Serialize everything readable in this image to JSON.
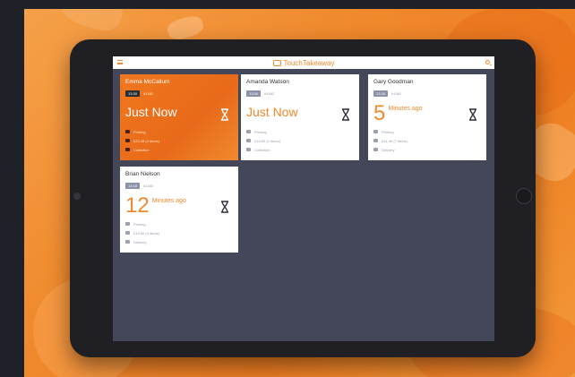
{
  "app": {
    "title": "TouchTakeaway"
  },
  "icons": {
    "menu": "menu-icon",
    "brand": "takeaway-logo-icon",
    "search": "search-icon",
    "hourglass": "hourglass-icon",
    "printing": "printer-icon",
    "items": "basket-icon",
    "delivery": "delivery-icon"
  },
  "colors": {
    "accent": "#f08a2e",
    "screen_bg": "#434757",
    "card_bg": "#ffffff"
  },
  "orders": [
    {
      "name": "Emma McCallum",
      "time": "13:30",
      "order_no": "#1482",
      "status_big": "Just Now",
      "active": true,
      "details": [
        "Printing",
        "£22.45 (4 items)",
        "Collection"
      ]
    },
    {
      "name": "Amanda Watson",
      "time": "13:30",
      "order_no": "#1482",
      "status_big": "Just Now",
      "active": false,
      "details": [
        "Printing",
        "£18.60 (2 items)",
        "Collection"
      ]
    },
    {
      "name": "Gary Goodman",
      "time": "13:26",
      "order_no": "#1481",
      "number": "5",
      "unit": "Minutes ago",
      "active": false,
      "details": [
        "Printing",
        "£31.40 (7 items)",
        "Delivery"
      ]
    },
    {
      "name": "Brian Nielson",
      "time": "13:18",
      "order_no": "#1480",
      "number": "12",
      "unit": "Minutes ago",
      "active": false,
      "details": [
        "Printing",
        "£19.80 (3 items)",
        "Delivery"
      ]
    }
  ]
}
